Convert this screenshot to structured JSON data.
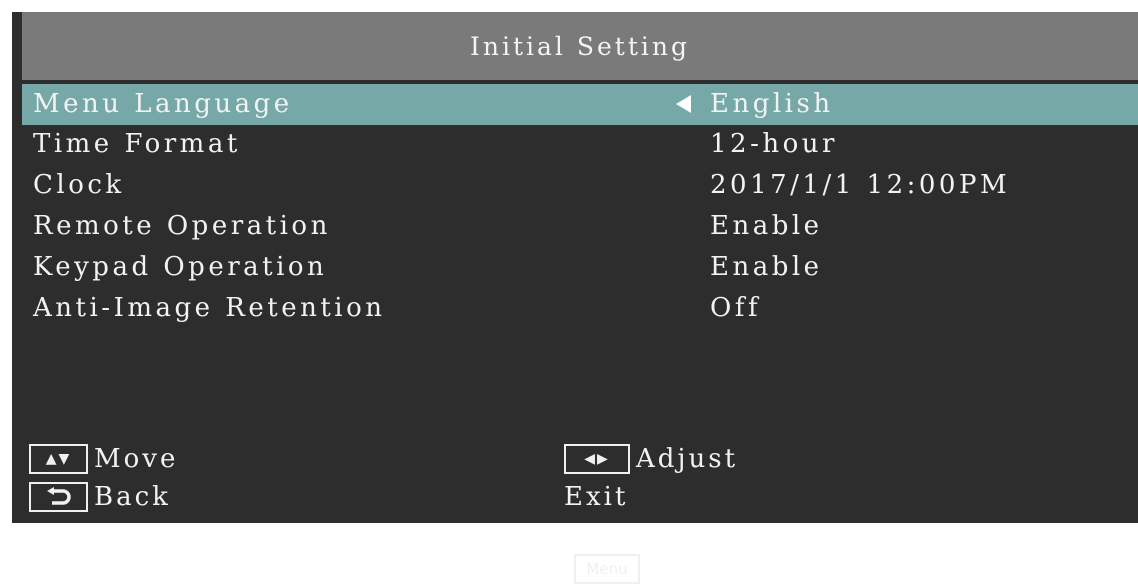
{
  "title": "Initial Setting",
  "menu": {
    "items": [
      {
        "label": "Menu Language",
        "value": "English",
        "selected": true
      },
      {
        "label": "Time Format",
        "value": "12-hour",
        "selected": false
      },
      {
        "label": "Clock",
        "value": "2017/1/1 12:00PM",
        "selected": false
      },
      {
        "label": "Remote Operation",
        "value": "Enable",
        "selected": false
      },
      {
        "label": "Keypad Operation",
        "value": "Enable",
        "selected": false
      },
      {
        "label": "Anti-Image Retention",
        "value": "Off",
        "selected": false
      }
    ]
  },
  "hints": {
    "move": {
      "key": "▲▼",
      "label": "Move"
    },
    "back": {
      "key": "back-arrow-icon",
      "label": "Back"
    },
    "adjust": {
      "key": "◀▶",
      "label": "Adjust"
    },
    "exit": {
      "key": "Menu",
      "label": "Exit"
    }
  },
  "colors": {
    "background": "#2d2d2d",
    "title_bar": "#7a7a7a",
    "selected_row": "#77a8a8",
    "text": "#f2f2f2"
  }
}
